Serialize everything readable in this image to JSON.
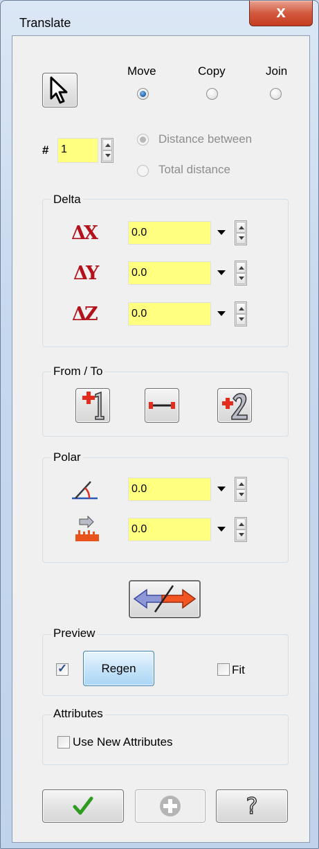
{
  "window": {
    "title": "Translate",
    "close_glyph": "x"
  },
  "mode": {
    "options": [
      {
        "label": "Move",
        "checked": true
      },
      {
        "label": "Copy",
        "checked": false
      },
      {
        "label": "Join",
        "checked": false
      }
    ]
  },
  "count": {
    "hash": "#",
    "value": "1"
  },
  "distance": {
    "options": [
      {
        "label": "Distance between",
        "checked": true,
        "enabled": false
      },
      {
        "label": "Total distance",
        "checked": false,
        "enabled": false
      }
    ]
  },
  "delta": {
    "title": "Delta",
    "rows": [
      {
        "icon": "delta-x-icon",
        "glyph": "ΔX",
        "value": "0.0"
      },
      {
        "icon": "delta-y-icon",
        "glyph": "ΔY",
        "value": "0.0"
      },
      {
        "icon": "delta-z-icon",
        "glyph": "ΔZ",
        "value": "0.0"
      }
    ]
  },
  "from_to": {
    "title": "From / To",
    "buttons": [
      "point-1-icon",
      "line-distance-icon",
      "point-2-icon"
    ]
  },
  "polar": {
    "title": "Polar",
    "rows": [
      {
        "icon": "angle-icon",
        "value": "0.0"
      },
      {
        "icon": "length-ruler-icon",
        "value": "0.0"
      }
    ]
  },
  "reverse": {
    "icon": "reverse-direction-icon"
  },
  "preview": {
    "title": "Preview",
    "regen_checked": true,
    "regen_label": "Regen",
    "fit_label": "Fit",
    "fit_checked": false
  },
  "attributes": {
    "title": "Attributes",
    "label": "Use New Attributes",
    "checked": false
  },
  "footer": {
    "ok_icon": "checkmark-icon",
    "apply_icon": "plus-icon",
    "help_icon": "help-icon",
    "help_glyph": "?"
  },
  "colors": {
    "field_bg": "#ffff80",
    "accent_red": "#b3121c",
    "dialog_bg": "#f0f0f0"
  }
}
